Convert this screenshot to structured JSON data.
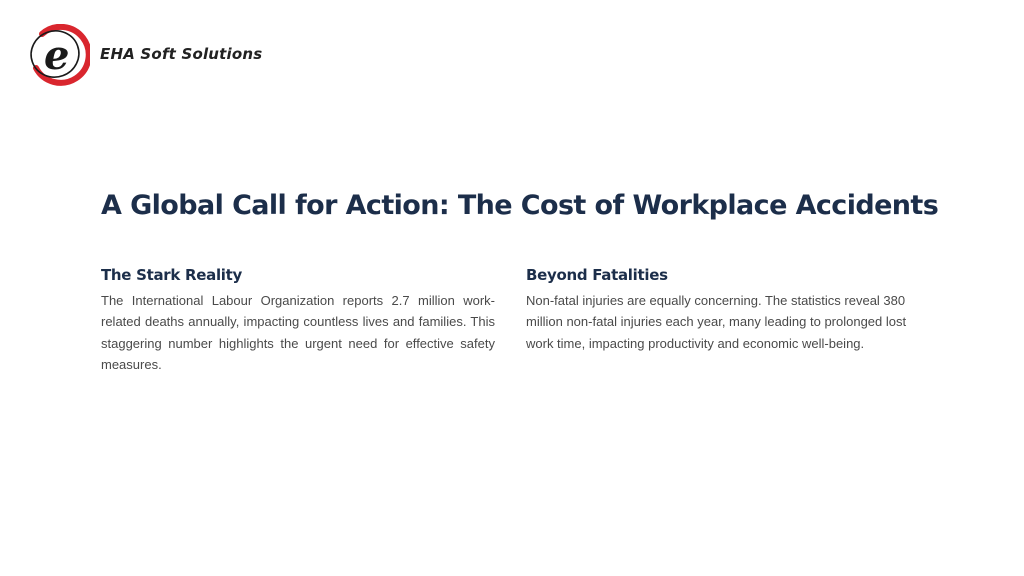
{
  "brand": {
    "name": "EHA Soft Solutions",
    "logo_letter": "e",
    "colors": {
      "ring": "#d9262e",
      "letter": "#1a1a1a"
    }
  },
  "title": "A Global Call for Action: The Cost of Workplace Accidents",
  "sections": [
    {
      "heading": "The Stark Reality",
      "body": "The International Labour Organization reports 2.7 million work-related deaths annually, impacting countless lives and families. This staggering number highlights the urgent need for effective safety measures."
    },
    {
      "heading": "Beyond Fatalities",
      "body": "Non-fatal injuries are equally concerning. The statistics reveal 380 million non-fatal injuries each year, many leading to prolonged lost work time, impacting productivity and economic well-being."
    }
  ],
  "colors": {
    "heading": "#1c2e4a",
    "body_text": "#4a4a4a",
    "background": "#ffffff"
  }
}
